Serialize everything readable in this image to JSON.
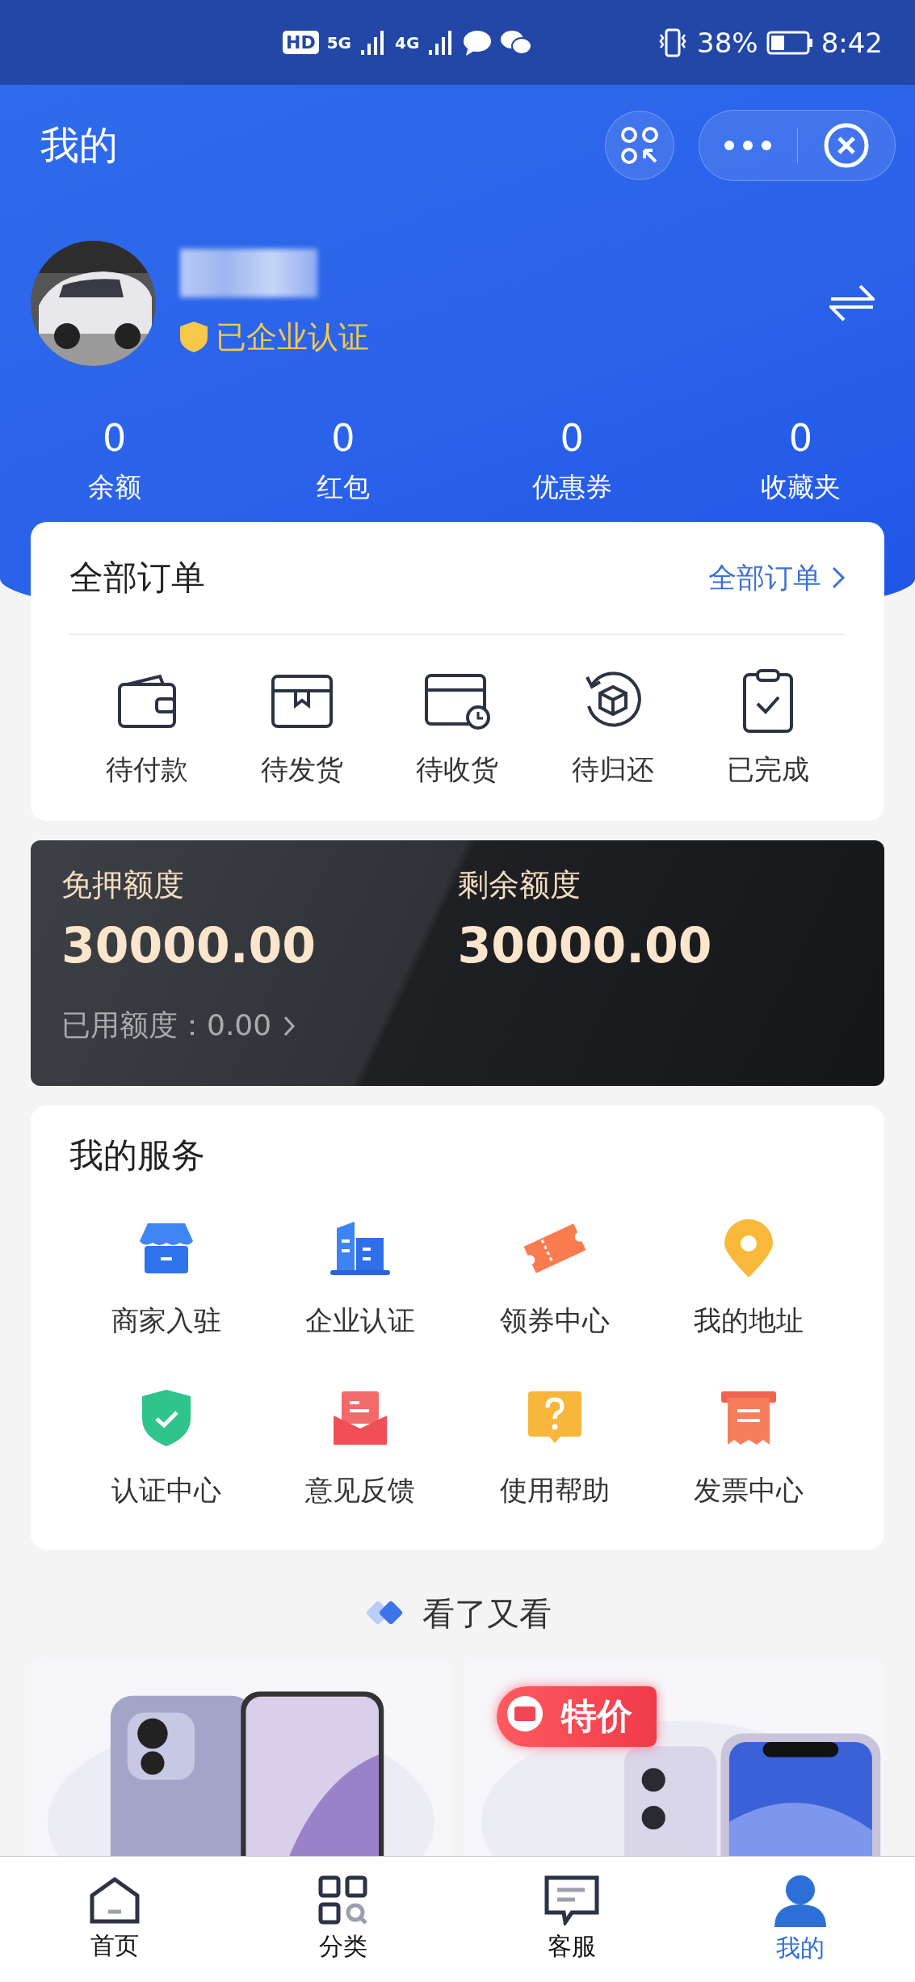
{
  "status_bar": {
    "network_labels": [
      "HD",
      "5G",
      "4G"
    ],
    "battery": "38%",
    "time": "8:42"
  },
  "header": {
    "title": "我的"
  },
  "profile": {
    "badge": "已企业认证"
  },
  "stats": [
    {
      "value": "0",
      "label": "余额"
    },
    {
      "value": "0",
      "label": "红包"
    },
    {
      "value": "0",
      "label": "优惠券"
    },
    {
      "value": "0",
      "label": "收藏夹"
    }
  ],
  "orders": {
    "title": "全部订单",
    "link": "全部订单",
    "items": [
      "待付款",
      "待发货",
      "待收货",
      "待归还",
      "已完成"
    ]
  },
  "credit": {
    "columns": [
      {
        "label": "免押额度",
        "value": "30000.00"
      },
      {
        "label": "剩余额度",
        "value": "30000.00"
      }
    ],
    "used": "已用额度：0.00"
  },
  "services": {
    "title": "我的服务",
    "items": [
      "商家入驻",
      "企业认证",
      "领券中心",
      "我的地址",
      "认证中心",
      "意见反馈",
      "使用帮助",
      "发票中心"
    ]
  },
  "recommend": {
    "title": "看了又看",
    "products": [
      {
        "kind": "picture"
      },
      {
        "kind": "picture",
        "badge": "特价"
      }
    ]
  },
  "tab_bar": [
    {
      "label": "首页",
      "selected": false
    },
    {
      "label": "分类",
      "selected": false
    },
    {
      "label": "客服",
      "selected": false
    },
    {
      "label": "我的",
      "selected": true
    }
  ]
}
